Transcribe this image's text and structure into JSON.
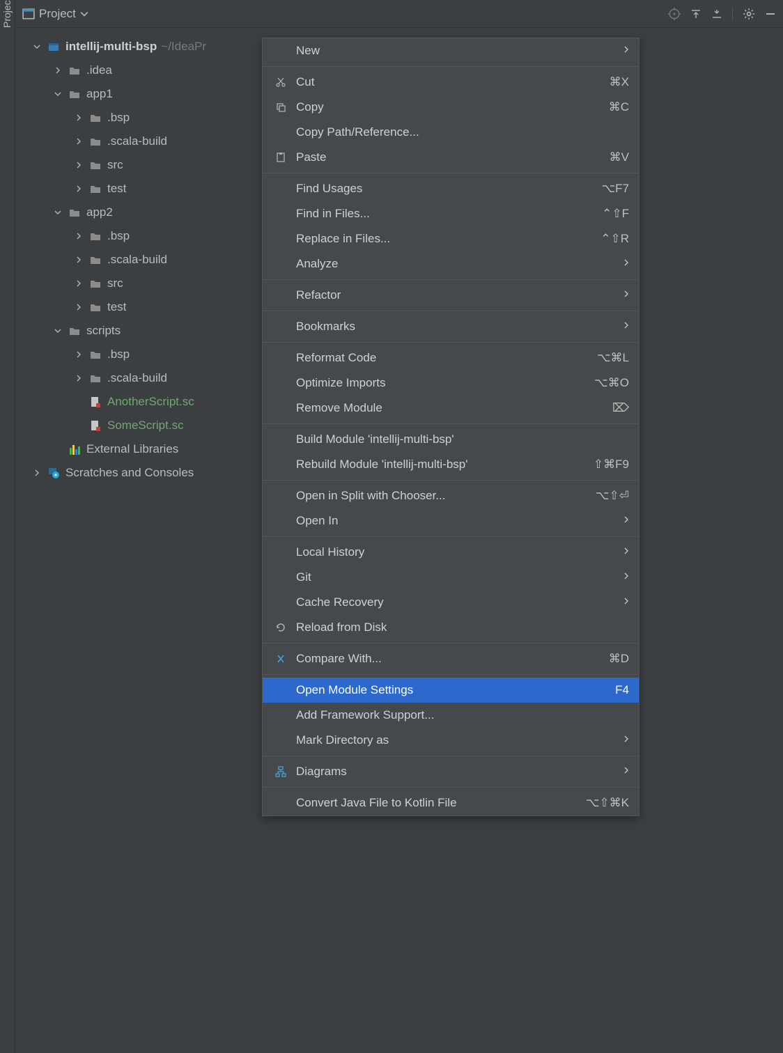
{
  "sidebar": {
    "tab": "Project"
  },
  "toolbar": {
    "title": "Project"
  },
  "tree": {
    "root": {
      "name": "intellij-multi-bsp",
      "path": "~/IdeaPr"
    },
    "idea": ".idea",
    "app1": "app1",
    "app1_bsp": ".bsp",
    "app1_scala": ".scala-build",
    "app1_src": "src",
    "app1_test": "test",
    "app2": "app2",
    "app2_bsp": ".bsp",
    "app2_scala": ".scala-build",
    "app2_src": "src",
    "app2_test": "test",
    "scripts": "scripts",
    "scripts_bsp": ".bsp",
    "scripts_scala": ".scala-build",
    "another_script": "AnotherScript.sc",
    "some_script": "SomeScript.sc",
    "external_libraries": "External Libraries",
    "scratches": "Scratches and Consoles"
  },
  "menu": {
    "new": "New",
    "cut": {
      "label": "Cut",
      "shortcut": "⌘X"
    },
    "copy": {
      "label": "Copy",
      "shortcut": "⌘C"
    },
    "copy_path": "Copy Path/Reference...",
    "paste": {
      "label": "Paste",
      "shortcut": "⌘V"
    },
    "find_usages": {
      "label": "Find Usages",
      "shortcut": "⌥F7"
    },
    "find_in_files": {
      "label": "Find in Files...",
      "shortcut": "⌃⇧F"
    },
    "replace_in_files": {
      "label": "Replace in Files...",
      "shortcut": "⌃⇧R"
    },
    "analyze": "Analyze",
    "refactor": "Refactor",
    "bookmarks": "Bookmarks",
    "reformat": {
      "label": "Reformat Code",
      "shortcut": "⌥⌘L"
    },
    "optimize": {
      "label": "Optimize Imports",
      "shortcut": "⌥⌘O"
    },
    "remove_module": {
      "label": "Remove Module",
      "shortcut": "⌦"
    },
    "build_module": "Build Module 'intellij-multi-bsp'",
    "rebuild_module": {
      "label": "Rebuild Module 'intellij-multi-bsp'",
      "shortcut": "⇧⌘F9"
    },
    "open_split": {
      "label": "Open in Split with Chooser...",
      "shortcut": "⌥⇧⏎"
    },
    "open_in": "Open In",
    "local_history": "Local History",
    "git": "Git",
    "cache_recovery": "Cache Recovery",
    "reload": "Reload from Disk",
    "compare": {
      "label": "Compare With...",
      "shortcut": "⌘D"
    },
    "open_module_settings": {
      "label": "Open Module Settings",
      "shortcut": "F4"
    },
    "add_framework": "Add Framework Support...",
    "mark_dir": "Mark Directory as",
    "diagrams": "Diagrams",
    "convert": {
      "label": "Convert Java File to Kotlin File",
      "shortcut": "⌥⇧⌘K"
    }
  }
}
